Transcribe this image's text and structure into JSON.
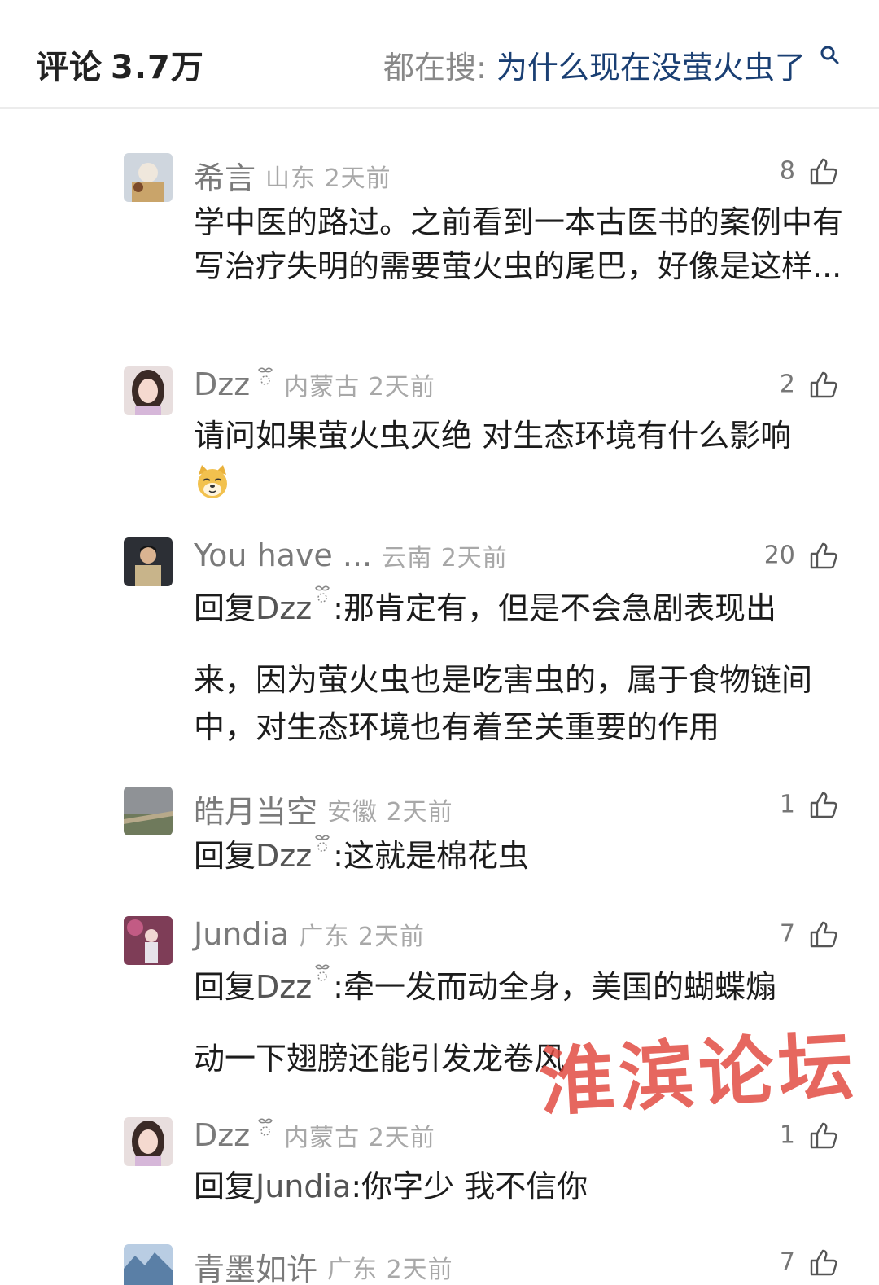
{
  "header": {
    "title": "评论",
    "count": "3.7万",
    "search_label": "都在搜:",
    "search_query": "为什么现在没萤火虫了"
  },
  "comments": [
    {
      "username": "希言",
      "location": "山东",
      "time": "2天前",
      "likes": "8",
      "text": "学中医的路过。之前看到一本古医书的案例中有写治疗失明的需要萤火虫的尾巴，好像是这样..."
    },
    {
      "username": "Dzz",
      "location": "内蒙古",
      "time": "2天前",
      "likes": "2",
      "text": "请问如果萤火虫灭绝 对生态环境有什么影响"
    },
    {
      "username": "You have ...",
      "location": "云南",
      "time": "2天前",
      "likes": "20",
      "reply_prefix": "回复",
      "reply_target": "Dzz",
      "text_line1": ":那肯定有，但是不会急剧表现出",
      "text_rest": "来，因为萤火虫也是吃害虫的，属于食物链间中，对生态环境也有着至关重要的作用"
    },
    {
      "username": "皓月当空",
      "location": "安徽",
      "time": "2天前",
      "likes": "1",
      "reply_prefix": "回复",
      "reply_target": "Dzz",
      "text_line1": ":这就是棉花虫"
    },
    {
      "username": "Jundia",
      "location": "广东",
      "time": "2天前",
      "likes": "7",
      "reply_prefix": "回复",
      "reply_target": "Dzz",
      "text_line1": ":牵一发而动全身，美国的蝴蝶煽",
      "text_rest": "动一下翅膀还能引发龙卷风"
    },
    {
      "username": "Dzz",
      "location": "内蒙古",
      "time": "2天前",
      "likes": "1",
      "reply_prefix": "回复",
      "reply_target": "Jundia",
      "text_line1": ":你字少 我不信你"
    },
    {
      "username": "青墨如许",
      "location": "广东",
      "time": "2天前",
      "likes": "7"
    }
  ],
  "watermark": "淮滨论坛",
  "colors": {
    "accent_search": "#1a3f73",
    "username": "#7a7a7a",
    "watermark": "#e1463c"
  }
}
